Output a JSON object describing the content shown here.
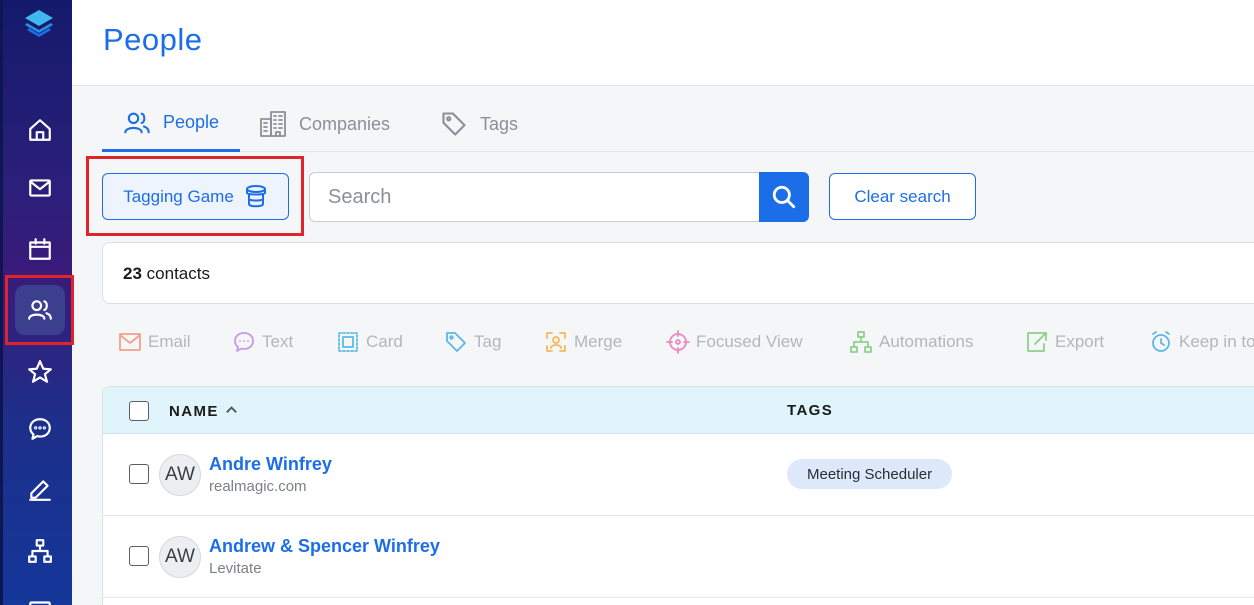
{
  "sidebar": {
    "items": [
      {
        "name": "home",
        "icon": "home-icon"
      },
      {
        "name": "inbox",
        "icon": "mail-icon"
      },
      {
        "name": "calendar",
        "icon": "calendar-icon"
      },
      {
        "name": "people",
        "icon": "users-icon",
        "active": true
      },
      {
        "name": "favorites",
        "icon": "star-icon"
      },
      {
        "name": "messages",
        "icon": "chat-icon"
      },
      {
        "name": "edit",
        "icon": "pencil-icon"
      },
      {
        "name": "automations",
        "icon": "hierarchy-icon"
      },
      {
        "name": "more",
        "icon": "card-icon"
      }
    ]
  },
  "header": {
    "title": "People"
  },
  "tabs": [
    {
      "label": "People",
      "icon": "users-icon",
      "active": true
    },
    {
      "label": "Companies",
      "icon": "building-icon"
    },
    {
      "label": "Tags",
      "icon": "tag-icon"
    }
  ],
  "toolbar": {
    "tagging_game_label": "Tagging Game",
    "search_placeholder": "Search",
    "clear_search_label": "Clear search"
  },
  "contacts": {
    "count": "23",
    "label": "contacts"
  },
  "actions": [
    {
      "label": "Email",
      "icon": "email-icon",
      "color": "#f4a08a"
    },
    {
      "label": "Text",
      "icon": "text-bubble-icon",
      "color": "#c59ae8"
    },
    {
      "label": "Card",
      "icon": "card-icon",
      "color": "#5bb8e8"
    },
    {
      "label": "Tag",
      "icon": "tag-icon",
      "color": "#5bb8e8"
    },
    {
      "label": "Merge",
      "icon": "merge-icon",
      "color": "#f5b85a"
    },
    {
      "label": "Focused View",
      "icon": "target-icon",
      "color": "#e88ac0"
    },
    {
      "label": "Automations",
      "icon": "hierarchy-icon",
      "color": "#8fd08a"
    },
    {
      "label": "Export",
      "icon": "export-icon",
      "color": "#8fd08a"
    },
    {
      "label": "Keep in to",
      "icon": "clock-icon",
      "color": "#5bb8e8"
    }
  ],
  "table": {
    "headers": {
      "name": "NAME",
      "tags": "TAGS"
    },
    "rows": [
      {
        "initials": "AW",
        "name": "Andre Winfrey",
        "sub": "realmagic.com",
        "tags": [
          "Meeting Scheduler"
        ]
      },
      {
        "initials": "AW",
        "name": "Andrew & Spencer Winfrey",
        "sub": "Levitate",
        "tags": []
      }
    ]
  },
  "colors": {
    "accent": "#1c6ee8",
    "highlight": "#e0242b",
    "header_bg": "#dff5fb",
    "tag_pill": "#dde9fb"
  }
}
